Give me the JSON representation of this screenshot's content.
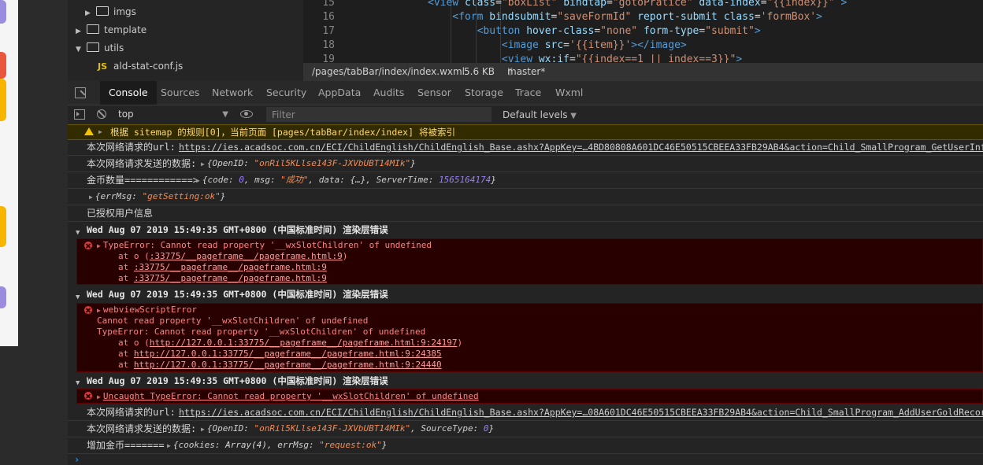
{
  "file_tree": {
    "items": [
      {
        "label": "imgs",
        "type": "folder",
        "expanded": false
      },
      {
        "label": "template",
        "type": "folder",
        "expanded": false
      },
      {
        "label": "utils",
        "type": "folder",
        "expanded": true
      },
      {
        "label": "ald-stat-conf.js",
        "type": "js-file",
        "badge": "JS"
      }
    ]
  },
  "editor": {
    "lines": [
      {
        "num": "15",
        "indent": 5,
        "html": "<span class='tag'>&lt;view</span> <span class='attr'>class</span>=<span class='str'>\"boxList\"</span> <span class='attr'>bindtap</span>=<span class='str'>\"gotoPratice\"</span> <span class='attr'>data-index</span>=<span class='str'>\"{{index}}\"</span> <span class='tag'>&gt;</span>"
      },
      {
        "num": "16",
        "indent": 6,
        "html": "<span class='tag'>&lt;form</span> <span class='attr'>bindsubmit</span>=<span class='str'>\"saveFormId\"</span> <span class='attr'>report-submit</span> <span class='attr'>class</span>=<span class='str'>'formBox'</span><span class='tag'>&gt;</span>"
      },
      {
        "num": "17",
        "indent": 7,
        "html": "<span class='tag'>&lt;button</span> <span class='attr'>hover-class</span>=<span class='str'>\"none\"</span> <span class='attr'>form-type</span>=<span class='str'>\"submit\"</span><span class='tag'>&gt;</span>"
      },
      {
        "num": "18",
        "indent": 8,
        "html": "<span class='tag'>&lt;image</span> <span class='attr'>src</span>=<span class='str'>'{{item}}'</span><span class='tag'>&gt;&lt;/image&gt;</span>"
      },
      {
        "num": "19",
        "indent": 8,
        "html": "<span class='tag'>&lt;view</span> <span class='attr'>wx:if</span>=<span class='str'>\"{{index==1 || index==3}}\"</span><span class='tag'>&gt;</span>"
      }
    ]
  },
  "editor_status": {
    "path": "/pages/tabBar/index/index.wxml",
    "size": "5.6 KB",
    "branch": "master*"
  },
  "devtools_tabs": [
    "Console",
    "Sources",
    "Network",
    "Security",
    "AppData",
    "Audits",
    "Sensor",
    "Storage",
    "Trace",
    "Wxml"
  ],
  "console_toolbar": {
    "context": "top",
    "filter_placeholder": "Filter",
    "levels": "Default levels"
  },
  "console": {
    "warning": "根据 sitemap 的规则[0]，当前页面 [pages/tabBar/index/index] 将被索引",
    "log1_label": "本次网络请求的url:",
    "log1_url": "https://ies.acadsoc.com.cn/ECI/ChildEnglish/ChildEnglish_Base.ashx?AppKey=…4BD80808A601DC46E50515CBEEA33FB29AB4&action=Child_SmallProgram_GetUserInfo",
    "log2_label": "本次网络请求发送的数据:",
    "log2_key1": "OpenID",
    "log2_val1": "\"onRil5KLlse143F-JXVbUBT14MIk\"",
    "log3_label": "金币数量============>",
    "log3_obj": {
      "k1": "code",
      "v1": "0",
      "k2": "msg",
      "v2": "\"成功\"",
      "k3": "data",
      "v3": "{…}",
      "k4": "ServerTime",
      "v4": "1565164174"
    },
    "log4_key": "errMsg",
    "log4_val": "\"getSetting:ok\"",
    "log5": "已授权用户信息",
    "group1": {
      "header": "Wed Aug 07 2019 15:49:35 GMT+0800 (中国标准时间) 渲染层错误",
      "l1": "TypeError: Cannot read property '__wxSlotChildren' of undefined",
      "l2_prefix": "at o (",
      "l2_link": ":33775/__pageframe__/pageframe.html:9",
      "l2_suffix": ")",
      "l3_prefix": "at ",
      "l3_link": ":33775/__pageframe__/pageframe.html:9",
      "l4_prefix": "at ",
      "l4_link": ":33775/__pageframe__/pageframe.html:9"
    },
    "group2": {
      "header": "Wed Aug 07 2019 15:49:35 GMT+0800 (中国标准时间) 渲染层错误",
      "l1": "webviewScriptError",
      "l2": "Cannot read property '__wxSlotChildren' of undefined",
      "l3": "TypeError: Cannot read property '__wxSlotChildren' of undefined",
      "l4_prefix": "at o (",
      "l4_link": "http://127.0.0.1:33775/__pageframe__/pageframe.html:9:24197",
      "l4_suffix": ")",
      "l5_prefix": "at ",
      "l5_link": "http://127.0.0.1:33775/__pageframe__/pageframe.html:9:24385",
      "l6_prefix": "at ",
      "l6_link": "http://127.0.0.1:33775/__pageframe__/pageframe.html:9:24440"
    },
    "group3": {
      "header": "Wed Aug 07 2019 15:49:35 GMT+0800 (中国标准时间) 渲染层错误",
      "l1": "Uncaught TypeError: Cannot read property '__wxSlotChildren' of undefined"
    },
    "log6_label": "本次网络请求的url:",
    "log6_url": "https://ies.acadsoc.com.cn/ECI/ChildEnglish/ChildEnglish_Base.ashx?AppKey=…08A601DC46E50515CBEEA33FB29AB4&action=Child_SmallProgram_AddUserGoldRecord",
    "log7_label": "本次网络请求发送的数据:",
    "log7_k1": "OpenID",
    "log7_v1": "\"onRil5KLlse143F-JXVbUBT14MIk\"",
    "log7_k2": "SourceType",
    "log7_v2": "0",
    "log8_label": "增加金币=======",
    "log8_k1": "cookies",
    "log8_v1": "Array(4)",
    "log8_k2": "errMsg",
    "log8_v2": "\"request:ok\""
  }
}
